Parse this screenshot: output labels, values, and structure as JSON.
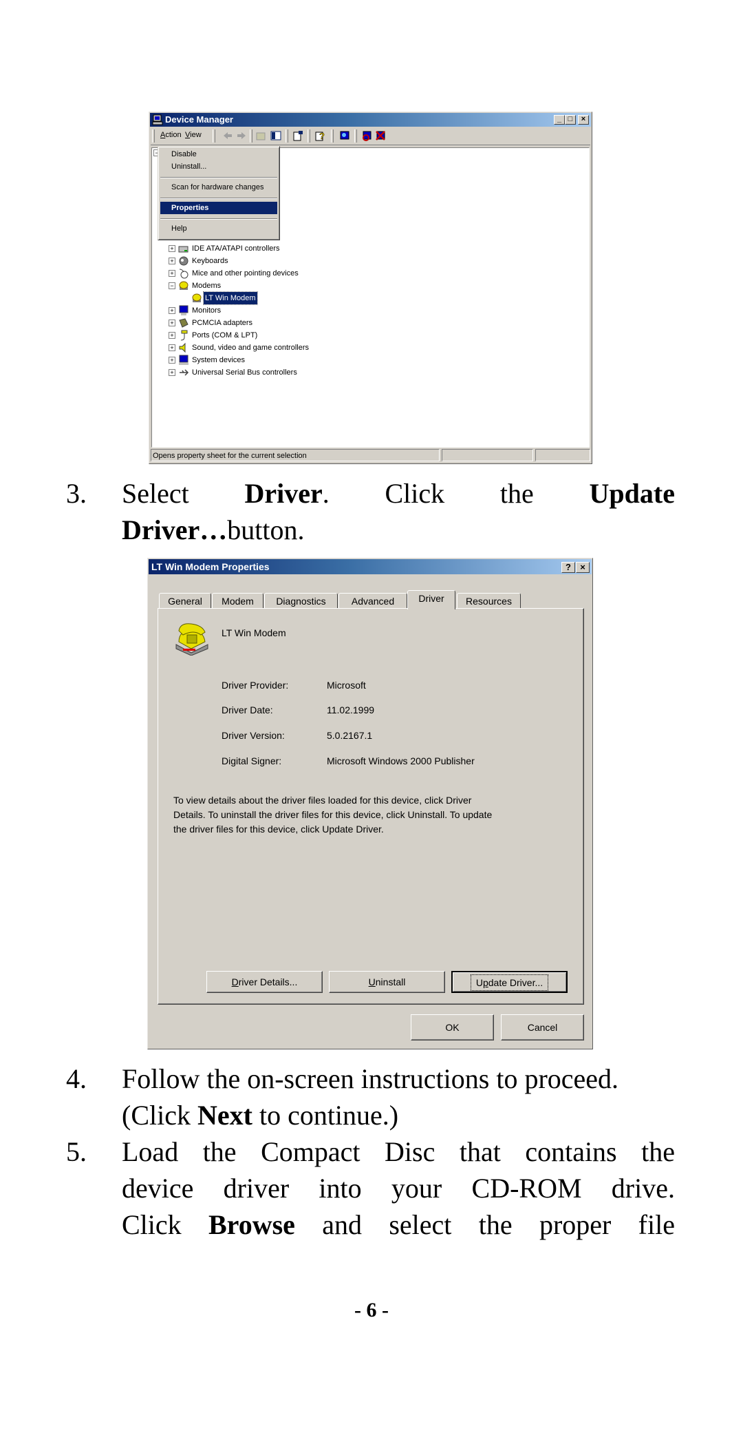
{
  "device_manager": {
    "title": "Device Manager",
    "window_controls": {
      "minimize": "_",
      "maximize": "□",
      "close": "×"
    },
    "menu": {
      "action": "Action",
      "view": "View"
    },
    "toolbar_icons": [
      "back-arrow-icon",
      "forward-arrow-icon",
      "up-folder-icon",
      "show-hide-tree-icon",
      "properties-icon",
      "help-icon",
      "scan-hardware-icon",
      "uninstall-icon",
      "disable-icon"
    ],
    "context_menu": {
      "items": [
        "Disable",
        "Uninstall...",
        "Scan for hardware changes",
        "Properties",
        "Help"
      ],
      "highlighted": "Properties"
    },
    "tree": [
      {
        "label": "IDE ATA/ATAPI controllers",
        "expander": "+",
        "level": 1
      },
      {
        "label": "Keyboards",
        "expander": "+",
        "level": 1
      },
      {
        "label": "Mice and other pointing devices",
        "expander": "+",
        "level": 1
      },
      {
        "label": "Modems",
        "expander": "−",
        "level": 1
      },
      {
        "label": "LT Win Modem",
        "expander": "",
        "level": 2,
        "selected": true
      },
      {
        "label": "Monitors",
        "expander": "+",
        "level": 1
      },
      {
        "label": "PCMCIA adapters",
        "expander": "+",
        "level": 1
      },
      {
        "label": "Ports (COM & LPT)",
        "expander": "+",
        "level": 1
      },
      {
        "label": "Sound, video and game controllers",
        "expander": "+",
        "level": 1
      },
      {
        "label": "System devices",
        "expander": "+",
        "level": 1
      },
      {
        "label": "Universal Serial Bus controllers",
        "expander": "+",
        "level": 1
      }
    ],
    "status_text": "Opens property sheet for the current selection"
  },
  "step3": {
    "number": "3.",
    "line1": {
      "pre": "Select",
      "bold1": "Driver",
      "mid1": ".",
      "mid2": "Click",
      "mid3": "the",
      "bold2": "Update"
    },
    "line2": {
      "bold": "Driver…",
      "rest": "button."
    }
  },
  "properties_dialog": {
    "title": "LT Win Modem Properties",
    "help_btn": "?",
    "close_btn": "×",
    "tabs": [
      "General",
      "Modem",
      "Diagnostics",
      "Advanced",
      "Driver",
      "Resources"
    ],
    "active_tab": "Driver",
    "device_name": "LT Win Modem",
    "fields": [
      {
        "label": "Driver Provider:",
        "value": "Microsoft"
      },
      {
        "label": "Driver Date:",
        "value": "11.02.1999"
      },
      {
        "label": "Driver Version:",
        "value": "5.0.2167.1"
      },
      {
        "label": "Digital Signer:",
        "value": "Microsoft Windows 2000 Publisher"
      }
    ],
    "description": [
      "To view details about the driver files loaded for this device, click Driver",
      "Details. To uninstall the driver files for this device, click Uninstall. To update",
      "the driver files for this device, click Update Driver."
    ],
    "buttons": {
      "driver_details": {
        "pre": "",
        "key": "D",
        "post": "river Details..."
      },
      "uninstall": {
        "pre": "",
        "key": "U",
        "post": "ninstall"
      },
      "update_driver": {
        "pre": "U",
        "key": "p",
        "post": "date Driver..."
      },
      "ok": "OK",
      "cancel": "Cancel"
    }
  },
  "step4": {
    "number": "4.",
    "line1": "Follow the on-screen instructions to proceed.",
    "line2": {
      "pre": "(Click ",
      "bold": "Next",
      "post": " to continue.)"
    }
  },
  "step5": {
    "number": "5.",
    "line1": "Load the Compact Disc that contains the",
    "line2": "device driver into your CD-ROM drive.",
    "line3": {
      "pre": "Click ",
      "bold": "Browse",
      "post": " and select the proper file"
    }
  },
  "page_number": "- 6 -"
}
